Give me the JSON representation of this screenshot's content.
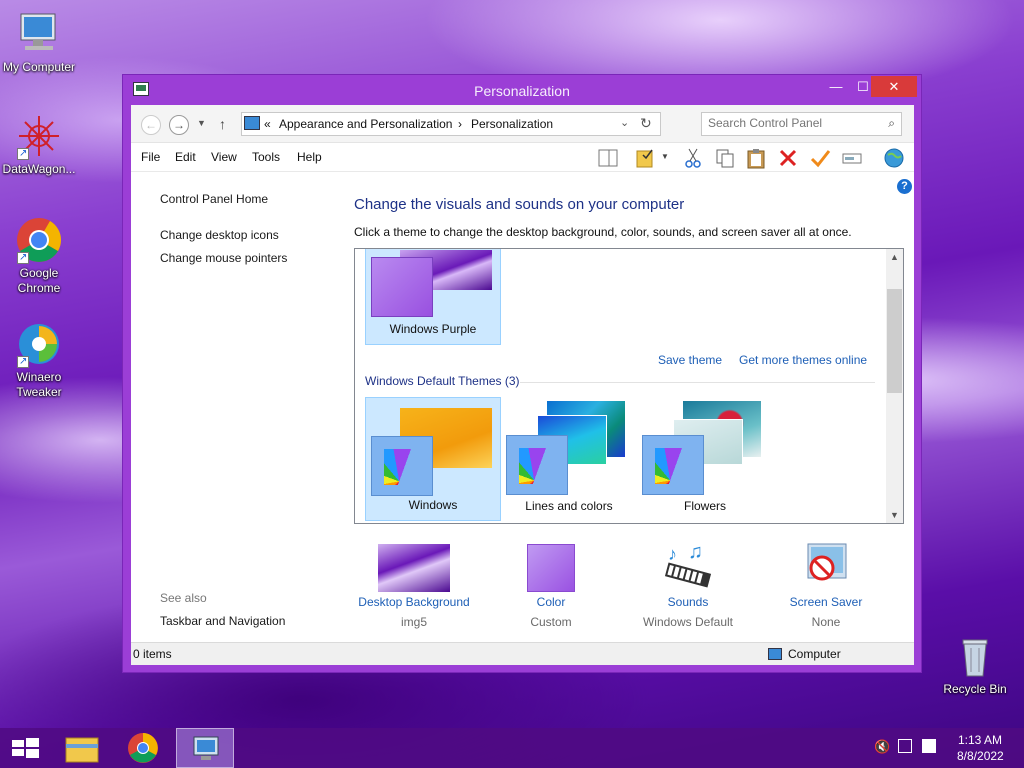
{
  "desktop": {
    "icons": [
      {
        "label": "My Computer"
      },
      {
        "label": "DataWagon..."
      },
      {
        "label": "Google Chrome"
      },
      {
        "label": "Winaero Tweaker"
      },
      {
        "label": "Recycle Bin"
      }
    ]
  },
  "window": {
    "title": "Personalization",
    "minimize": "—",
    "maximize": "☐",
    "close": "✕"
  },
  "address": {
    "chevrons": "«",
    "crumb1": "Appearance and Personalization",
    "sep": "›",
    "crumb2": "Personalization",
    "search_placeholder": "Search Control Panel"
  },
  "menu": {
    "file": "File",
    "edit": "Edit",
    "view": "View",
    "tools": "Tools",
    "help": "Help"
  },
  "left": {
    "home": "Control Panel Home",
    "desktop_icons": "Change desktop icons",
    "mouse_pointers": "Change mouse pointers",
    "see_also": "See also",
    "taskbar_nav": "Taskbar and Navigation"
  },
  "main": {
    "heading": "Change the visuals and sounds on your computer",
    "subtext": "Click a theme to change the desktop background, color, sounds, and screen saver all at once.",
    "my_theme": "Windows Purple",
    "save_theme": "Save theme",
    "get_more": "Get more themes online",
    "group_title": "Windows Default Themes (3)",
    "themes": [
      "Windows",
      "Lines and colors",
      "Flowers"
    ]
  },
  "bottom": {
    "items": [
      {
        "caption": "Desktop Background",
        "sub": "img5"
      },
      {
        "caption": "Color",
        "sub": "Custom"
      },
      {
        "caption": "Sounds",
        "sub": "Windows Default"
      },
      {
        "caption": "Screen Saver",
        "sub": "None"
      }
    ]
  },
  "status": {
    "items": "0 items",
    "location": "Computer"
  },
  "clock": {
    "time": "1:13 AM",
    "date": "8/8/2022"
  },
  "colors": {
    "window_frame": "#9b3ed6",
    "close_button": "#d93a3a",
    "link": "#1e5fb6",
    "heading": "#1e3287",
    "selection": "#cce8ff"
  }
}
